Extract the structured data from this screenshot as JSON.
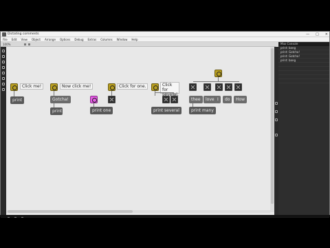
{
  "window": {
    "title": "Dictating comments",
    "controls": {
      "minimize": "—",
      "maximize": "□",
      "close": "✕"
    }
  },
  "menubar": {
    "items": [
      "File",
      "Edit",
      "View",
      "Object",
      "Arrange",
      "Options",
      "Debug",
      "Extras",
      "Columns",
      "Window",
      "Help"
    ]
  },
  "toolbar": {
    "zoom": "100%"
  },
  "sidepanel": {
    "header": "Max Console",
    "lines": [
      "print: bang",
      "print: Gotcha!",
      "print: Gotcha!",
      "print: bang"
    ]
  },
  "patch": {
    "example1": {
      "comment": "Click me!",
      "object": "print"
    },
    "example2": {
      "comment": "Now click me!",
      "message": "Gotcha!",
      "object": "print"
    },
    "example3": {
      "comment": "Click for one.",
      "object": "print one"
    },
    "example4": {
      "comment": "Click for several.",
      "object": "print several"
    },
    "example5": {
      "messages": [
        "thee",
        "I",
        "love",
        "I",
        "do",
        "How"
      ],
      "object": "print many"
    }
  },
  "colors": {
    "bang_yellow": "#b99f1f",
    "bang_pink": "#e35be3",
    "object_bg": "#595959",
    "canvas": "#e8e8e8"
  },
  "icons": [
    "app-icon",
    "minimize-icon",
    "maximize-icon",
    "close-icon",
    "lock-icon",
    "presentation-icon"
  ]
}
